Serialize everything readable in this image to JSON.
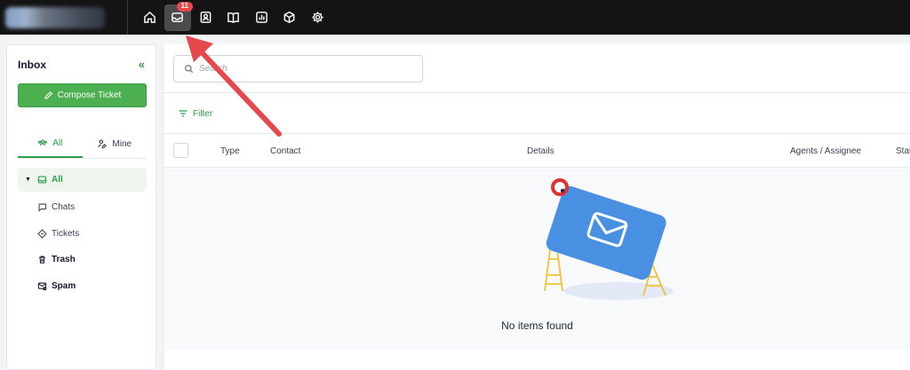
{
  "topnav": {
    "icons": [
      "home-icon",
      "inbox-icon",
      "contacts-icon",
      "book-icon",
      "reports-icon",
      "box-icon",
      "gear-icon"
    ],
    "inbox_badge": "11"
  },
  "sidebar": {
    "title": "Inbox",
    "compose_label": "Compose Ticket",
    "tabs": [
      {
        "label": "All",
        "active": true
      },
      {
        "label": "Mine",
        "active": false
      }
    ],
    "items": [
      {
        "label": "All",
        "icon": "inbox-icon",
        "active": true
      },
      {
        "label": "Chats",
        "icon": "chat-icon"
      },
      {
        "label": "Tickets",
        "icon": "ticket-icon"
      },
      {
        "label": "Trash",
        "icon": "trash-icon"
      },
      {
        "label": "Spam",
        "icon": "spam-icon"
      }
    ]
  },
  "main": {
    "search": {
      "placeholder": "Search",
      "value": ""
    },
    "filter_label": "Filter",
    "columns": [
      "Type",
      "Contact",
      "Details",
      "Agents / Assignee",
      "Stat"
    ],
    "empty_text": "No items found"
  },
  "colors": {
    "accent": "#4caf50",
    "badge": "#e5484d",
    "arrow": "#e5484d",
    "topbar": "#141414"
  }
}
